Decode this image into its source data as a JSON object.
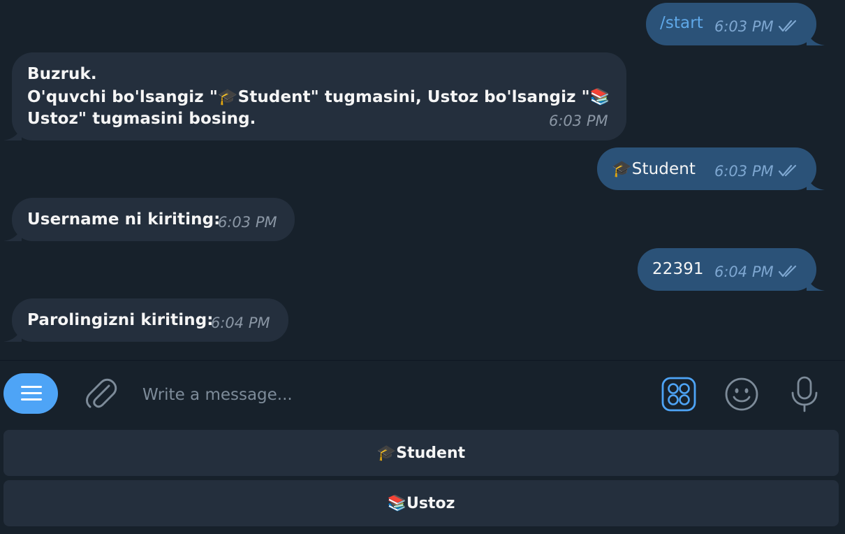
{
  "messages": [
    {
      "text": "/start",
      "time": "6:03 PM"
    },
    {
      "lines": [
        "Buzruk.",
        "O'quvchi bo'lsangiz \"🎓Student\" tugmasini, Ustoz bo'lsangiz \"📚",
        "Ustoz\" tugmasini bosing."
      ],
      "time": "6:03 PM"
    },
    {
      "emoji": "🎓",
      "text": "Student",
      "time": "6:03 PM"
    },
    {
      "text": "Username ni kiriting:",
      "time": "6:03 PM"
    },
    {
      "text": "22391",
      "time": "6:04 PM"
    },
    {
      "text": "Parolingizni kiriting:",
      "time": "6:04 PM"
    }
  ],
  "input": {
    "placeholder": "Write a message..."
  },
  "keyboard": [
    {
      "emoji": "🎓",
      "label": "Student"
    },
    {
      "emoji": "📚",
      "label": "Ustoz"
    }
  ],
  "colors": {
    "background": "#17212b",
    "incoming_bubble": "#242f3d",
    "outgoing_bubble": "#2b5278",
    "accent": "#4ea4f6"
  },
  "icons": [
    "menu-icon",
    "attach-icon",
    "sticker-icon",
    "emoji-icon",
    "microphone-icon",
    "double-check-icon"
  ]
}
